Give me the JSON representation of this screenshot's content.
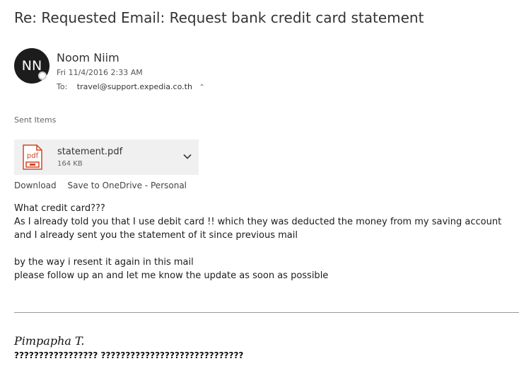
{
  "email": {
    "subject": "Re: Requested Email: Request bank credit card statement",
    "sender": {
      "initials": "NN",
      "name": "Noom Niim",
      "date": "Fri 11/4/2016 2:33 AM",
      "to_label": "To:",
      "to_address": "travel@support.expedia.co.th"
    },
    "folder": "Sent Items",
    "attachment": {
      "icon_label": "pdf",
      "name": "statement.pdf",
      "size": "164 KB",
      "actions": [
        "Download",
        "Save to OneDrive - Personal"
      ]
    },
    "body": [
      "What credit card???",
      "As I already told you that I use debit card !! which they was deducted the money from my saving account",
      "and I already sent you the statement of it since previous mail",
      "",
      "by the way i resent it again in this mail",
      "please follow up an and let me know the update as soon as possible"
    ],
    "signature": {
      "name": "Pimpapha T.",
      "line": "????????????????? ?????????????????????????????"
    }
  },
  "colors": {
    "avatar_bg": "#1c1c1c",
    "pdf_red": "#d24726",
    "attachment_bg": "#f0f0f0"
  }
}
